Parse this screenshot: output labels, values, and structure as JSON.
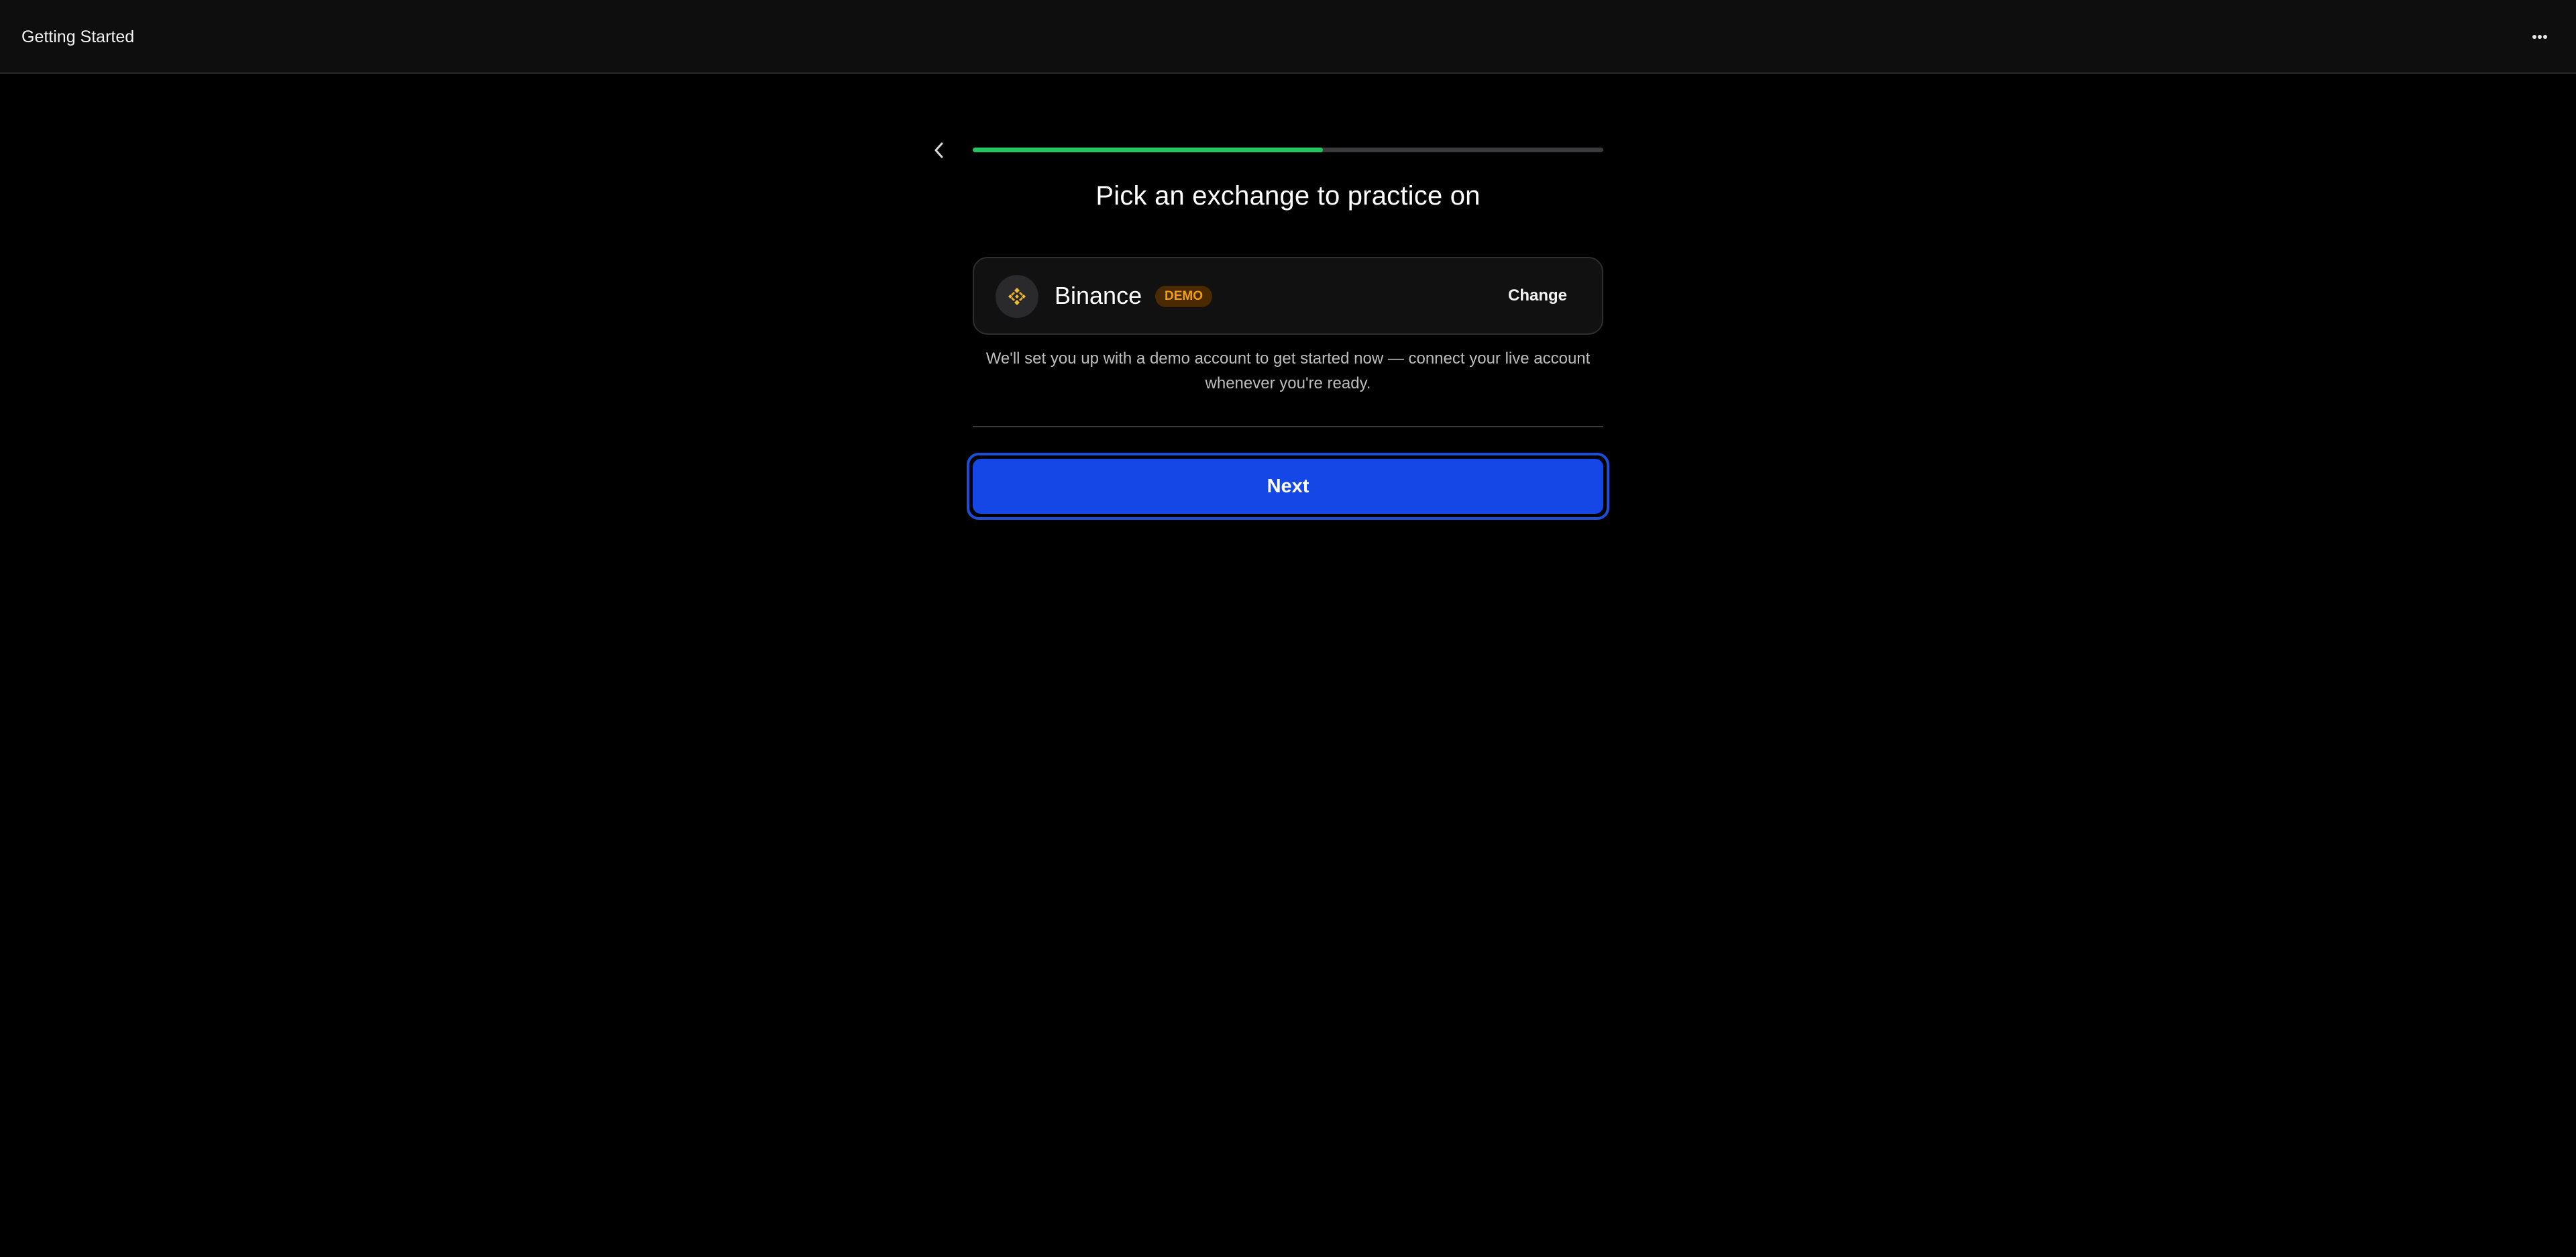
{
  "header": {
    "title": "Getting Started",
    "more_icon": "more-horizontal-icon"
  },
  "onboarding": {
    "back_icon": "chevron-left-icon",
    "progress_fraction": 0.555,
    "progress_color": "#22c55e",
    "heading": "Pick an exchange to practice on",
    "exchange": {
      "name": "Binance",
      "logo_icon": "binance-logo-icon",
      "badge": "DEMO",
      "change_label": "Change"
    },
    "helper_text": "We'll set you up with a demo account to get started now — connect your live account whenever you're ready.",
    "next_label": "Next",
    "accent_color": "#1447e6",
    "badge_color": "#f59e0b"
  }
}
